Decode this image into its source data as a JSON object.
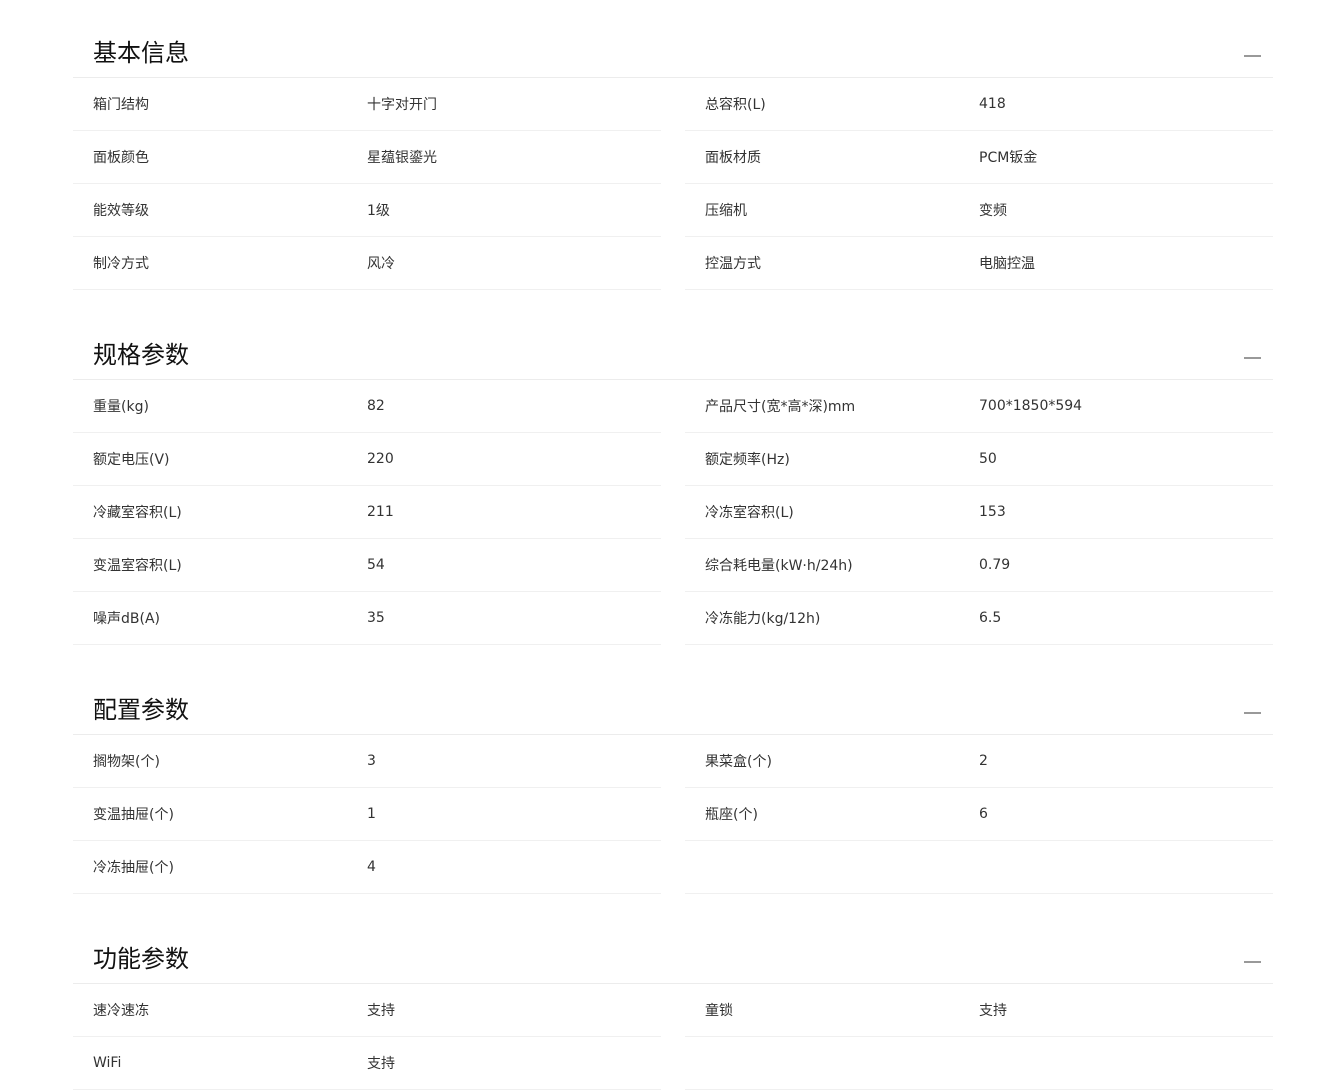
{
  "sections": [
    {
      "title": "基本信息",
      "rows": [
        {
          "label": "箱门结构",
          "value": "十字对开门"
        },
        {
          "label": "总容积(L)",
          "value": "418"
        },
        {
          "label": "面板颜色",
          "value": "星蕴银鎏光"
        },
        {
          "label": "面板材质",
          "value": "PCM钣金"
        },
        {
          "label": "能效等级",
          "value": "1级"
        },
        {
          "label": "压缩机",
          "value": "变频"
        },
        {
          "label": "制冷方式",
          "value": "风冷"
        },
        {
          "label": "控温方式",
          "value": "电脑控温"
        }
      ]
    },
    {
      "title": "规格参数",
      "rows": [
        {
          "label": "重量(kg)",
          "value": "82"
        },
        {
          "label": "产品尺寸(宽*高*深)mm",
          "value": "700*1850*594"
        },
        {
          "label": "额定电压(V)",
          "value": "220"
        },
        {
          "label": "额定频率(Hz)",
          "value": "50"
        },
        {
          "label": "冷藏室容积(L)",
          "value": "211"
        },
        {
          "label": "冷冻室容积(L)",
          "value": "153"
        },
        {
          "label": "变温室容积(L)",
          "value": "54"
        },
        {
          "label": "综合耗电量(kW·h/24h)",
          "value": "0.79"
        },
        {
          "label": "噪声dB(A)",
          "value": "35"
        },
        {
          "label": "冷冻能力(kg/12h)",
          "value": "6.5"
        }
      ]
    },
    {
      "title": "配置参数",
      "rows": [
        {
          "label": "搁物架(个)",
          "value": "3"
        },
        {
          "label": "果菜盒(个)",
          "value": "2"
        },
        {
          "label": "变温抽屉(个)",
          "value": "1"
        },
        {
          "label": "瓶座(个)",
          "value": "6"
        },
        {
          "label": "冷冻抽屉(个)",
          "value": "4"
        }
      ]
    },
    {
      "title": "功能参数",
      "rows": [
        {
          "label": "速冷速冻",
          "value": "支持"
        },
        {
          "label": "童锁",
          "value": "支持"
        },
        {
          "label": "WiFi",
          "value": "支持"
        }
      ]
    }
  ],
  "icons": {
    "collapse": "minus-icon"
  },
  "colors": {
    "title": "#111111",
    "text": "#333333",
    "divider": "#ececec",
    "icon": "#999999"
  }
}
